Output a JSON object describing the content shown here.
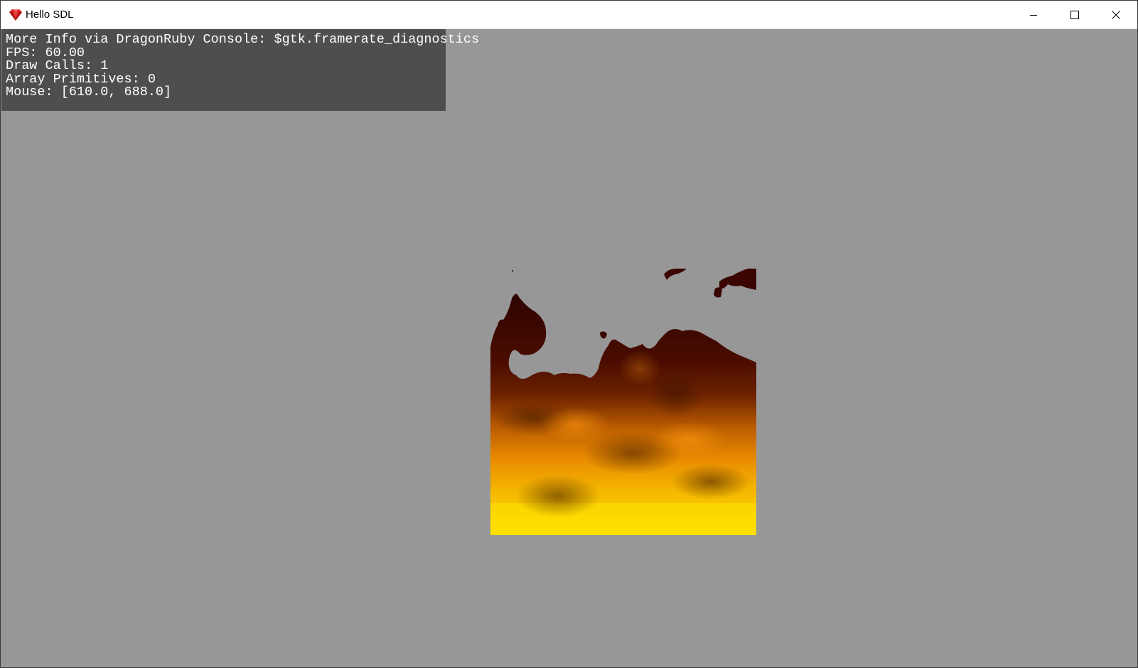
{
  "window": {
    "title": "Hello SDL",
    "app_icon": "ruby-gem-icon",
    "controls": {
      "minimize_icon": "minimize-icon",
      "maximize_icon": "maximize-icon",
      "close_icon": "close-icon"
    }
  },
  "canvas": {
    "background_color": "#979797",
    "diagnostics": {
      "background_color": "#4e4e4e",
      "lines": [
        "More Info via DragonRuby Console: $gtk.framerate_diagnostics",
        "FPS: 60.00",
        "Draw Calls: 1",
        "Array Primitives: 0",
        "Mouse: [610.0, 688.0]"
      ]
    },
    "fire_sprite": {
      "colors": [
        "#3a0500",
        "#7a2400",
        "#e88a00",
        "#ffe000"
      ]
    }
  }
}
